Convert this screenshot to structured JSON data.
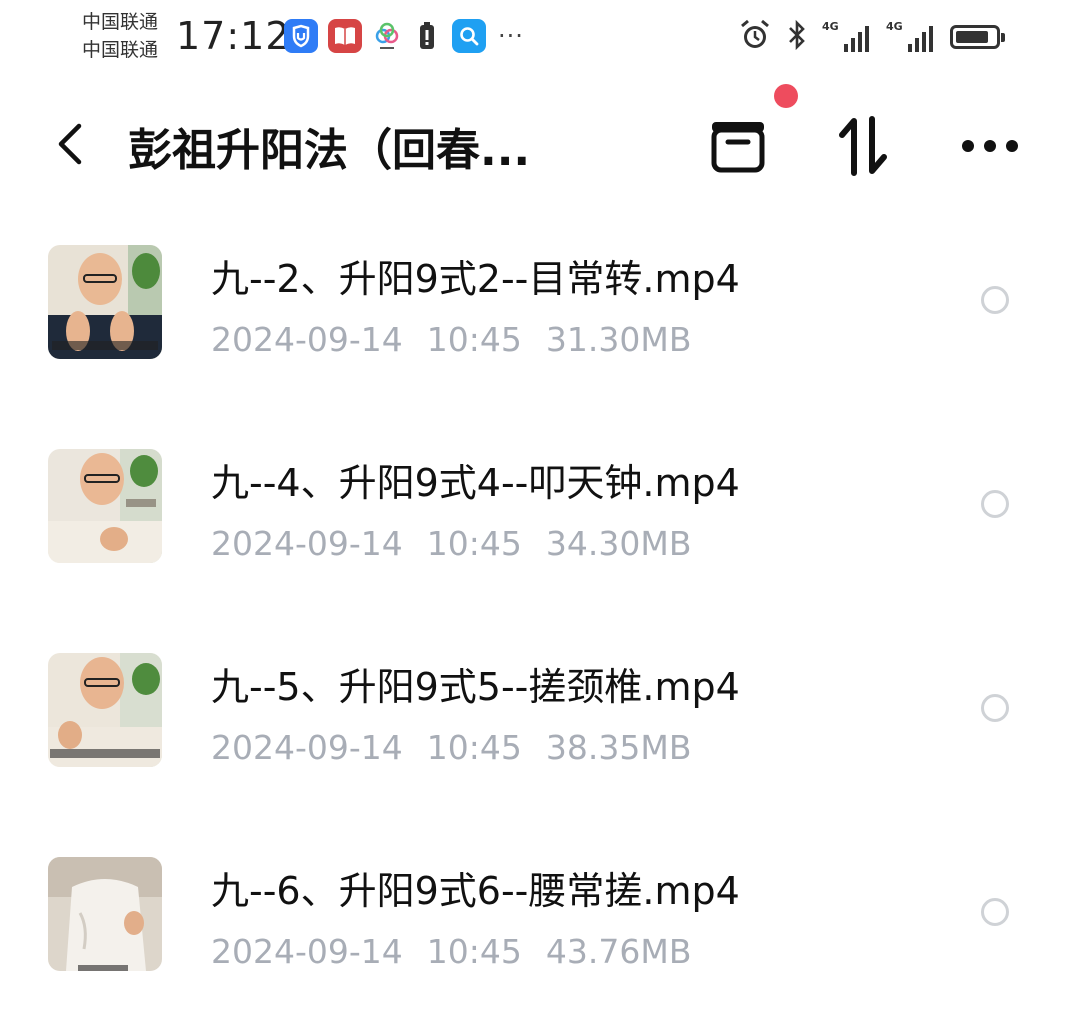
{
  "status_bar": {
    "carrier_1": "中国联通",
    "carrier_2": "中国联通",
    "time": "17:12",
    "more": "···",
    "signal_label_1": "4G",
    "signal_label_2": "4G",
    "battery_level": 0.85
  },
  "header": {
    "title": "彭祖升阳法（回春...",
    "has_notification_dot": true
  },
  "files": [
    {
      "name": "九--2、升阳9式2--目常转.mp4",
      "date": "2024-09-14",
      "time": "10:45",
      "size": "31.30MB"
    },
    {
      "name": "九--4、升阳9式4--叩天钟.mp4",
      "date": "2024-09-14",
      "time": "10:45",
      "size": "34.30MB"
    },
    {
      "name": "九--5、升阳9式5--搓颈椎.mp4",
      "date": "2024-09-14",
      "time": "10:45",
      "size": "38.35MB"
    },
    {
      "name": "九--6、升阳9式6--腰常搓.mp4",
      "date": "2024-09-14",
      "time": "10:45",
      "size": "43.76MB"
    }
  ],
  "colors": {
    "accent_dot": "#ee4c5e",
    "meta_text": "#a8adb6",
    "title_text": "#111111"
  }
}
